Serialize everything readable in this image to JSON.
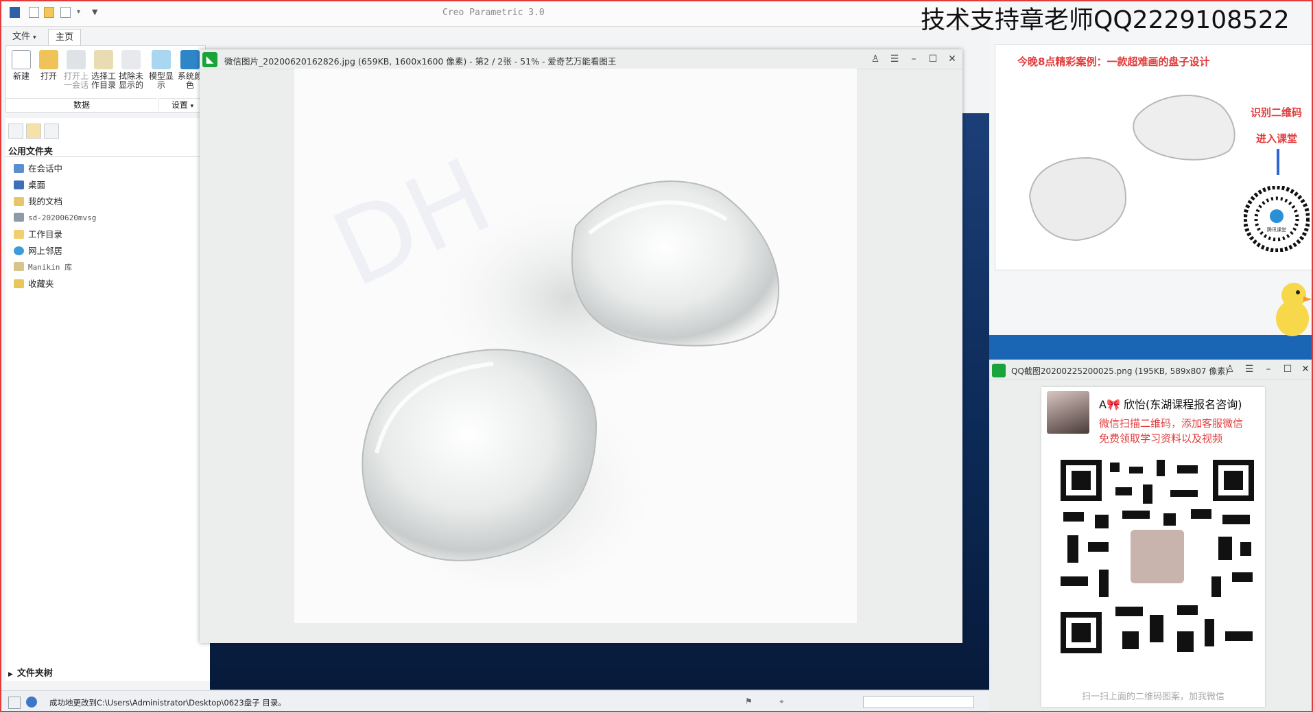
{
  "creo": {
    "window_title": "Creo Parametric 3.0",
    "tabs": [
      {
        "label": "文件"
      },
      {
        "label": "主页"
      }
    ],
    "ribbon": {
      "buttons": [
        {
          "label": "新建"
        },
        {
          "label": "打开"
        },
        {
          "label": "打开上一会话"
        },
        {
          "label": "选择工作目录"
        },
        {
          "label": "拭除未显示的"
        },
        {
          "label": "模型显示"
        },
        {
          "label": "系统颜色"
        }
      ],
      "groups": {
        "data": "数据",
        "settings": "设置"
      }
    },
    "navigator": {
      "header": "公用文件夹",
      "items": [
        {
          "label": "在会话中"
        },
        {
          "label": "桌面"
        },
        {
          "label": "我的文档"
        },
        {
          "label": "sd-20200620mvsg"
        },
        {
          "label": "工作目录"
        },
        {
          "label": "网上邻居"
        },
        {
          "label": "Manikin 库"
        },
        {
          "label": "收藏夹"
        }
      ],
      "folder_tree": "文件夹树"
    },
    "status_message": "成功地更改到C:\\Users\\Administrator\\Desktop\\0623盘子 目录。"
  },
  "viewer": {
    "title": "微信图片_20200620162826.jpg (659KB, 1600x1600 像素) - 第2 / 2张 - 51% - 爱奇艺万能看图王",
    "zoom_percent": 51
  },
  "overlay": {
    "title": "技术支持章老师QQ2229108522"
  },
  "ad": {
    "headline": "今晚8点精彩案例：一款超难画的盘子设计",
    "side_line1": "识别二维码",
    "side_line2": "进入课堂",
    "qr_center_label": "腾讯课堂"
  },
  "viewer2": {
    "title": "QQ截图20200225200025.png (195KB, 589x807 像素)"
  },
  "contact": {
    "name": "A🎀 欣怡(东湖课程报名咨询)",
    "line1": "微信扫描二维码，添加客服微信",
    "line2": "免费领取学习资料以及视频",
    "footer": "扫一扫上面的二维码图案，加我微信"
  },
  "colors": {
    "accent_red": "#e23b3b",
    "viewer_green": "#1aa33a",
    "creo_blue": "#1c3f78"
  }
}
